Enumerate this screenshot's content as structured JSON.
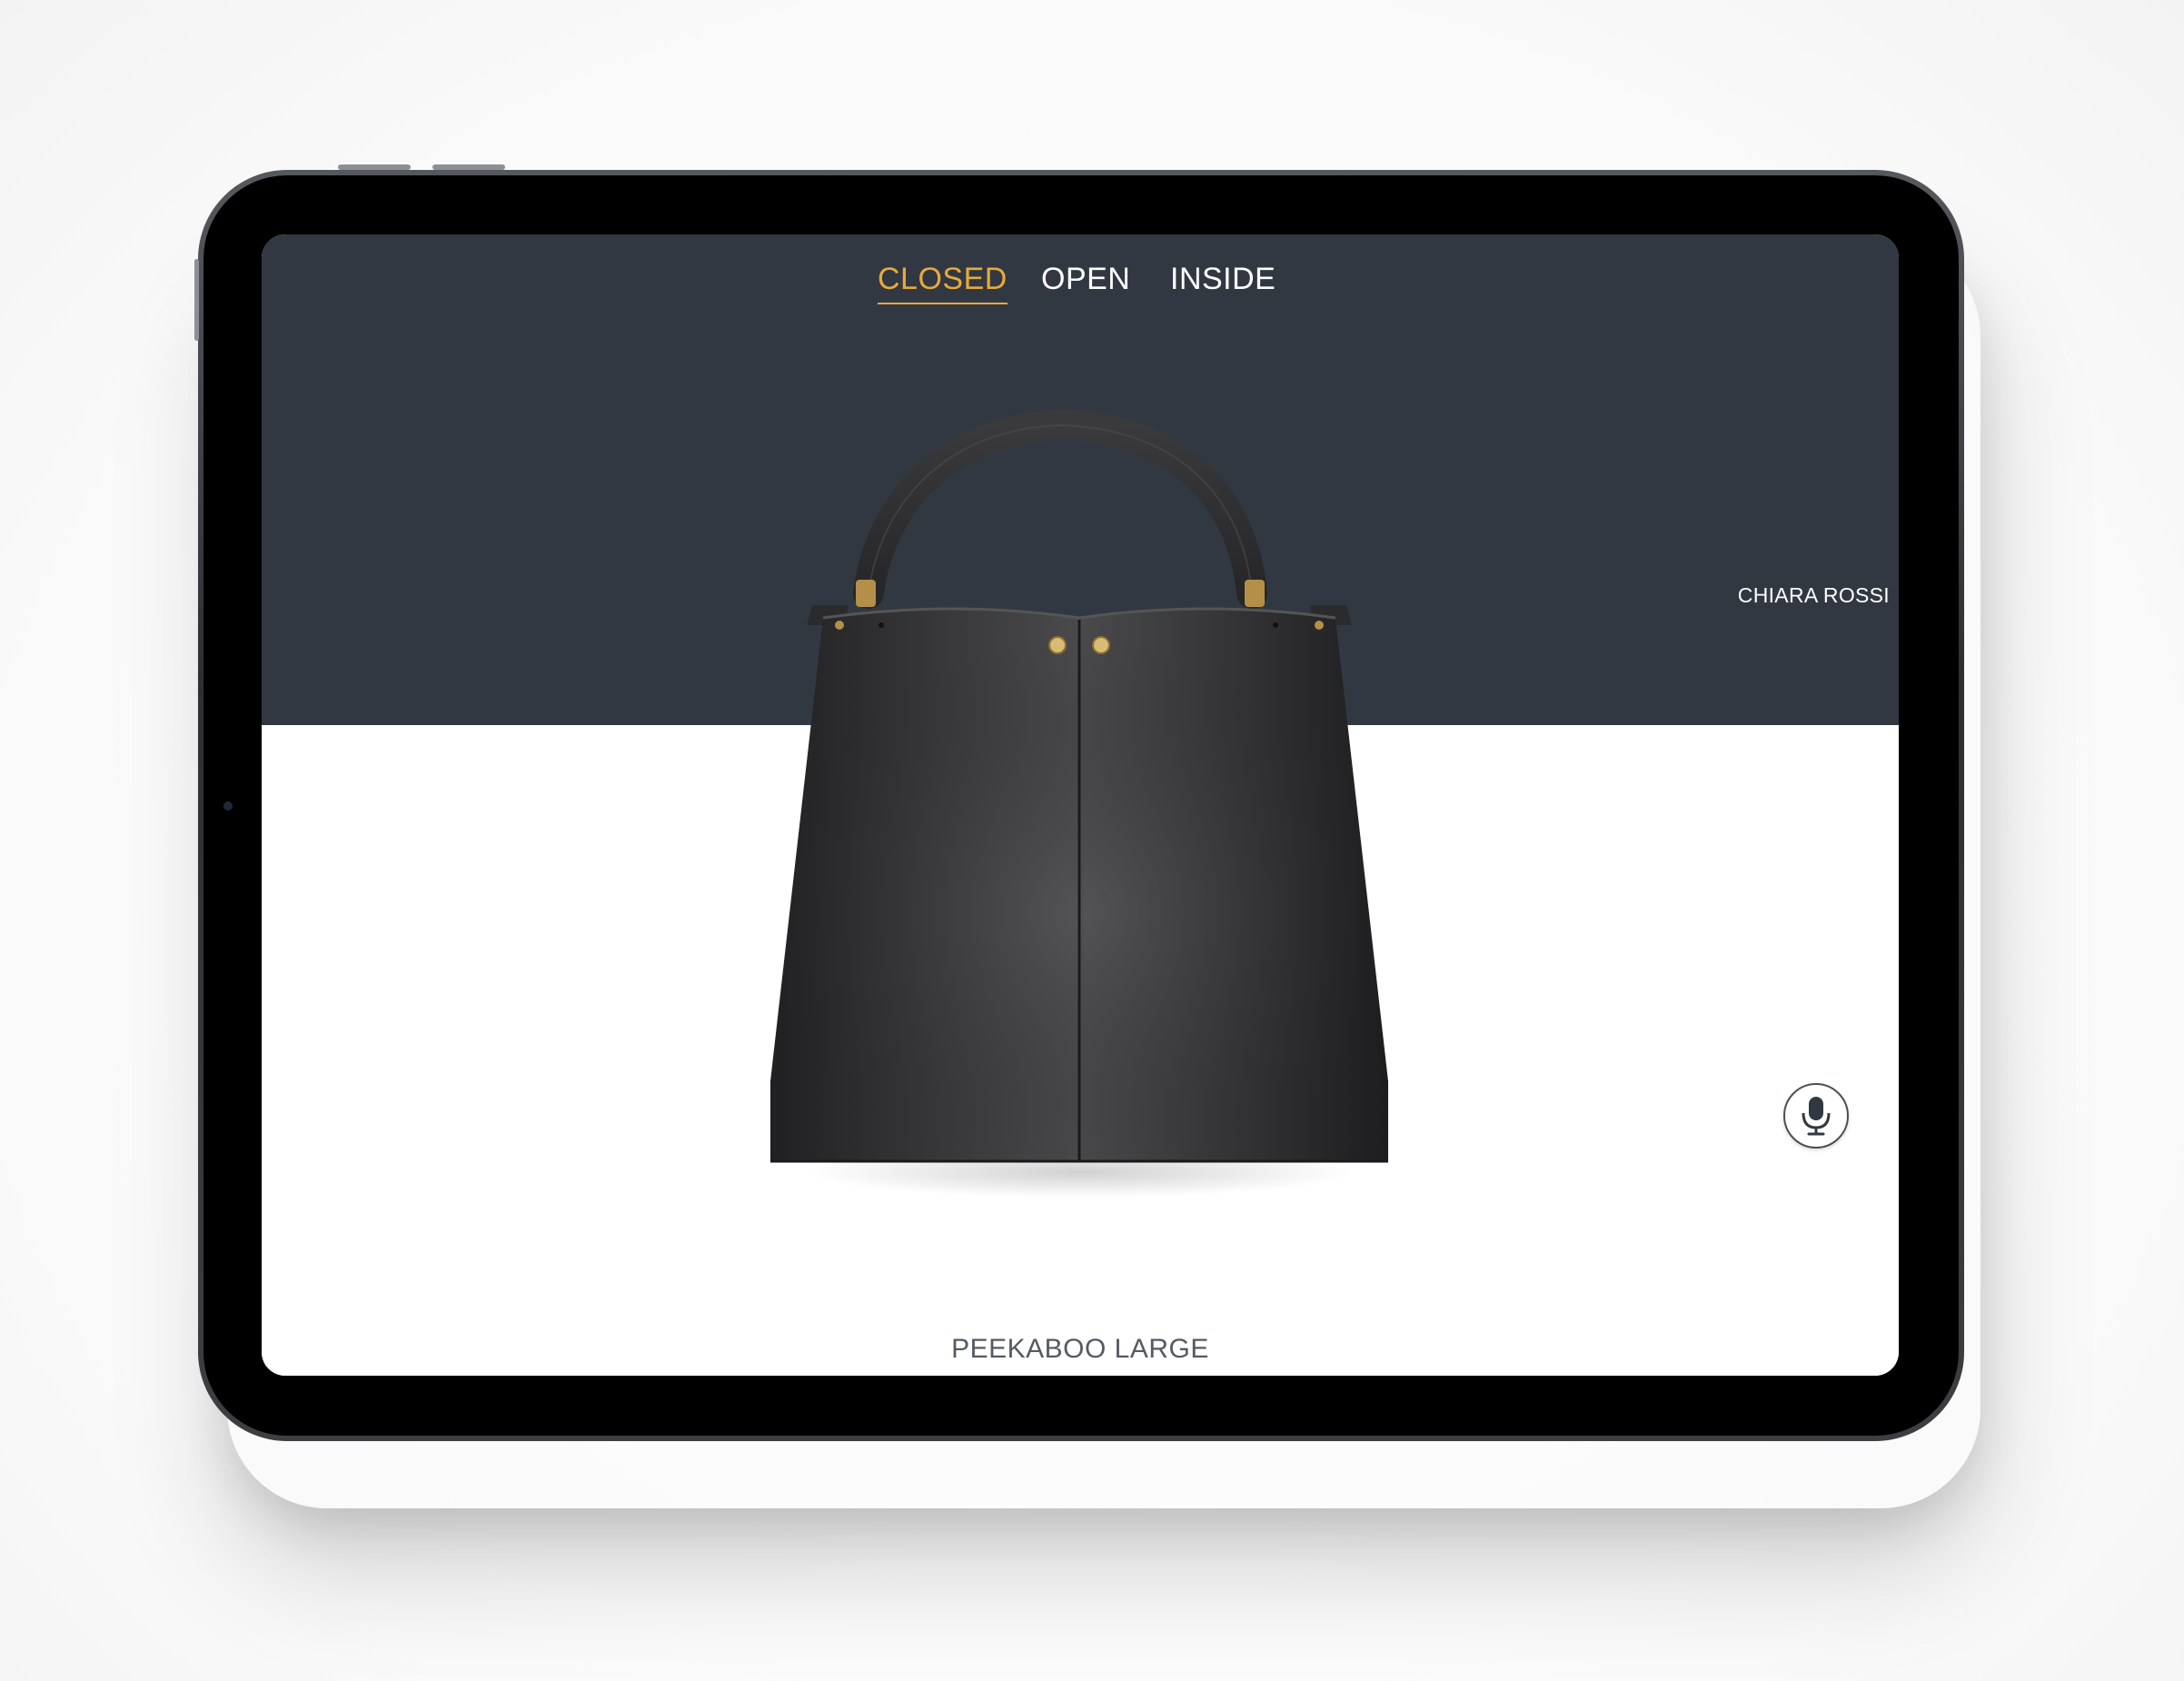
{
  "tabs": [
    {
      "label": "CLOSED",
      "active": true
    },
    {
      "label": "OPEN",
      "active": false
    },
    {
      "label": "INSIDE",
      "active": false
    }
  ],
  "brand": {
    "label": "CHIARA ROSSI"
  },
  "product": {
    "name": "PEEKABOO LARGE"
  },
  "colors": {
    "accent": "#e6ab3a",
    "top_panel": "#323842",
    "bottom_panel": "#ffffff"
  },
  "icons": {
    "mic": "microphone-icon",
    "product": "handbag-image"
  }
}
